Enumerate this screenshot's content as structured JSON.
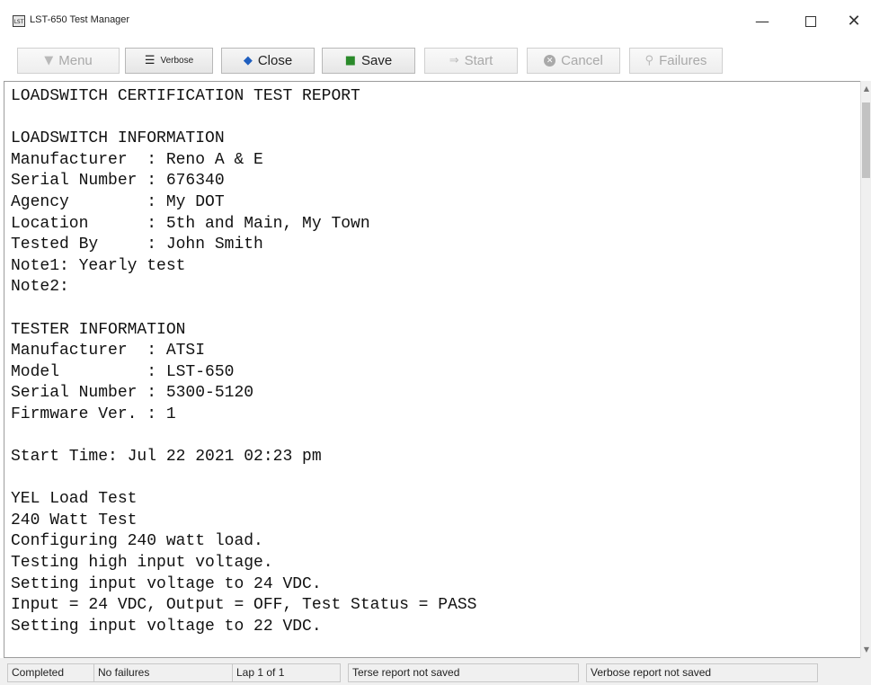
{
  "window": {
    "title": "LST-650 Test Manager",
    "icon": "app-icon",
    "icon_glyph": "LST",
    "minimize_glyph": "—",
    "close_glyph": "✕"
  },
  "toolbar": {
    "menu_label": "Menu",
    "menu_icon": "menu-icon",
    "verbose_label": "Verbose",
    "verbose_icon": "document-icon",
    "close_label": "Close",
    "close_icon": "close-arrow-icon",
    "save_label": "Save",
    "save_icon": "floppy-disk-icon",
    "start_label": "Start",
    "start_icon": "arrow-right-icon",
    "cancel_label": "Cancel",
    "cancel_icon": "cancel-circle-icon",
    "failures_label": "Failures",
    "failures_icon": "magnifier-icon",
    "disabled_color": "#a9a9a9"
  },
  "report": {
    "lines": [
      "LOADSWITCH CERTIFICATION TEST REPORT",
      "",
      "LOADSWITCH INFORMATION",
      "Manufacturer  : Reno A & E",
      "Serial Number : 676340",
      "Agency        : My DOT",
      "Location      : 5th and Main, My Town",
      "Tested By     : John Smith",
      "Note1: Yearly test",
      "Note2:",
      "",
      "TESTER INFORMATION",
      "Manufacturer  : ATSI",
      "Model         : LST-650",
      "Serial Number : 5300-5120",
      "Firmware Ver. : 1",
      "",
      "Start Time: Jul 22 2021 02:23 pm",
      "",
      "YEL Load Test",
      "240 Watt Test",
      "Configuring 240 watt load.",
      "Testing high input voltage.",
      "Setting input voltage to 24 VDC.",
      "Input = 24 VDC, Output = OFF, Test Status = PASS",
      "Setting input voltage to 22 VDC."
    ]
  },
  "statusbar": {
    "state": "Completed",
    "failures": "No failures",
    "lap": "Lap 1 of 1",
    "terse": "Terse report not saved",
    "verbose": "Verbose report not saved"
  }
}
